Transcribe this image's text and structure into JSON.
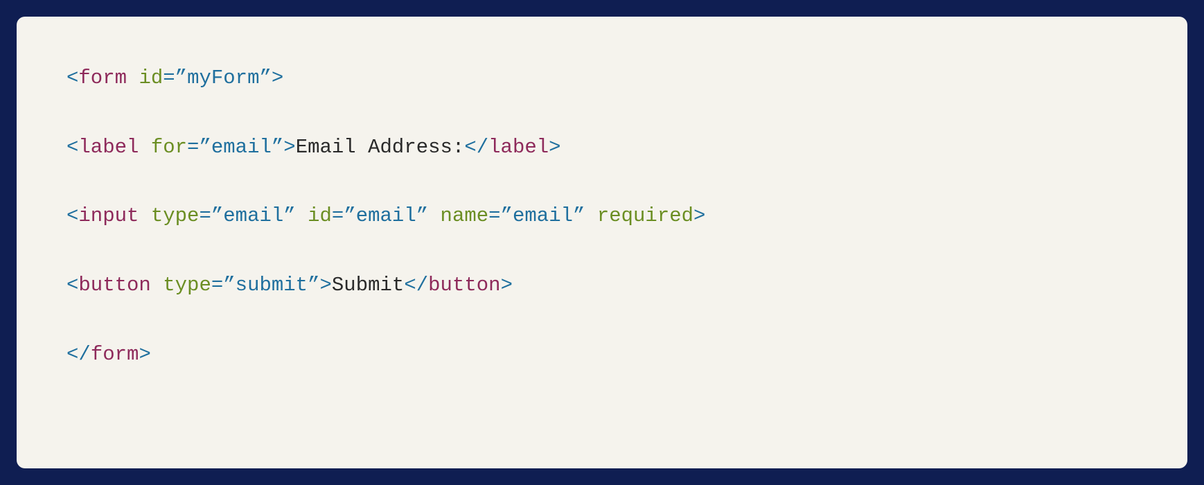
{
  "code": {
    "line1": {
      "open_bracket": "<",
      "tag": "form",
      "space1": " ",
      "attr_id": "id",
      "eq1": "=",
      "val_id_open": "”",
      "val_id": "myForm",
      "val_id_close": "”",
      "close_bracket": ">"
    },
    "line2": {
      "open_bracket": "<",
      "tag": "label",
      "space1": " ",
      "attr_for": "for",
      "eq1": "=",
      "val_for_open": "”",
      "val_for": "email",
      "val_for_close": "”",
      "close_bracket1": ">",
      "text": "Email Address:",
      "close_open": "</",
      "close_tag": "label",
      "close_bracket2": ">"
    },
    "line3": {
      "open_bracket": "<",
      "tag": "input",
      "space1": " ",
      "attr_type": "type",
      "eq1": "=",
      "val_type_open": "”",
      "val_type": "email",
      "val_type_close": "”",
      "space2": " ",
      "attr_id": "id",
      "eq2": "=",
      "val_id_open": "”",
      "val_id": "email",
      "val_id_close": "”",
      "space3": " ",
      "attr_name2": "name",
      "eq3": "=",
      "val_name_open": "”",
      "val_name": "email",
      "val_name_close": "”",
      "space4": " ",
      "attr_required": "required",
      "close_bracket": ">"
    },
    "line4": {
      "open_bracket": "<",
      "tag": "button",
      "space1": " ",
      "attr_type": "type",
      "eq1": "=",
      "val_type_open": "”",
      "val_type": "submit",
      "val_type_close": "”",
      "close_bracket1": ">",
      "text": "Submit",
      "close_open": "</",
      "close_tag": "button",
      "close_bracket2": ">"
    },
    "line5": {
      "close_open": "</",
      "tag": "form",
      "close_bracket": ">"
    }
  }
}
